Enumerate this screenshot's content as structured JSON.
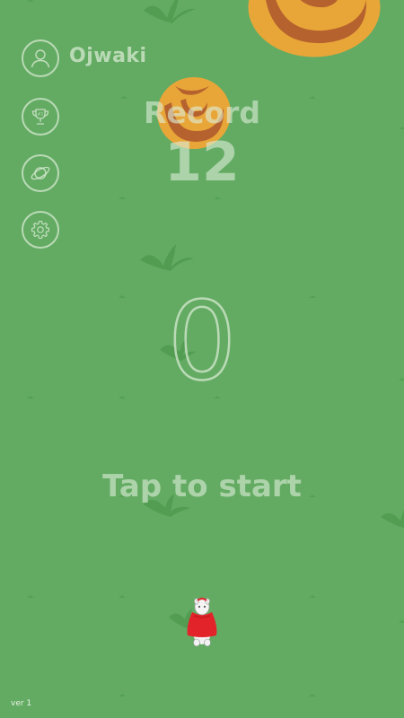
{
  "player": {
    "username": "Ojwaki",
    "character": "red-caped-goat-runner"
  },
  "record": {
    "label": "Record",
    "value": "12"
  },
  "score": {
    "current": "0"
  },
  "prompt": {
    "start": "Tap to start"
  },
  "menu": [
    {
      "id": "profile",
      "icon": "user-profile-icon"
    },
    {
      "id": "leaderboard",
      "icon": "trophy-icon"
    },
    {
      "id": "worlds",
      "icon": "planet-icon"
    },
    {
      "id": "settings",
      "icon": "gear-icon"
    }
  ],
  "footer": {
    "version": "ver 1"
  },
  "colors": {
    "background": "#63ab63",
    "ui_text": "#dcebd7",
    "tornado_outer": "#e9a638",
    "tornado_inner": "#b5622e",
    "grass": "#4c9a4c",
    "player_cape": "#e3232a"
  }
}
